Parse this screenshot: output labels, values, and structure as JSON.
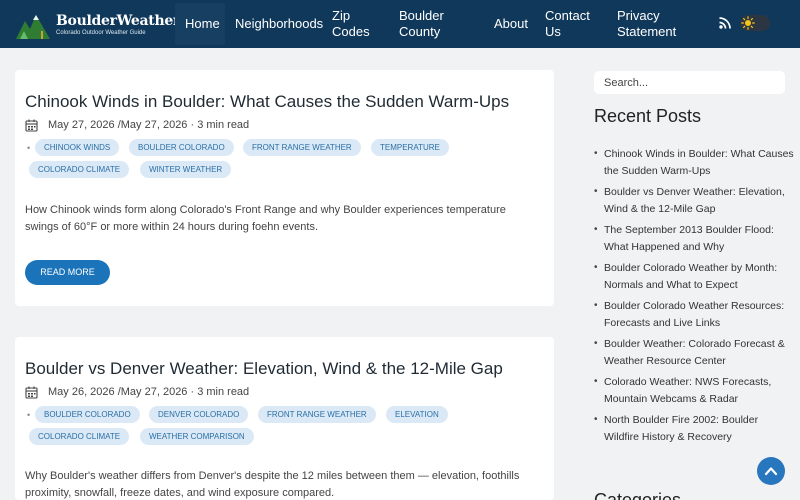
{
  "header": {
    "logo_title": "BoulderWeather.com",
    "logo_subtitle": "Colorado Outdoor Weather Guide",
    "nav": [
      {
        "label": "Home"
      },
      {
        "label": "Neighborhoods"
      },
      {
        "label": "Zip Codes"
      },
      {
        "label": "Boulder County"
      },
      {
        "label": "About"
      },
      {
        "label": "Contact Us"
      },
      {
        "label": "Privacy Statement"
      }
    ],
    "active_nav": "Home",
    "theme": "light"
  },
  "posts": [
    {
      "title": "Chinook Winds in Boulder: What Causes the Sudden Warm-Ups",
      "meta": "May 27, 2026 /May 27, 2026 · 3 min read",
      "tags": [
        "CHINOOK WINDS",
        "BOULDER COLORADO",
        "FRONT RANGE WEATHER",
        "TEMPERATURE",
        "COLORADO CLIMATE",
        "WINTER WEATHER"
      ],
      "excerpt": "How Chinook winds form along Colorado's Front Range and why Boulder experiences temperature swings of 60°F or more within 24 hours during foehn events.",
      "read_more": "READ MORE"
    },
    {
      "title": "Boulder vs Denver Weather: Elevation, Wind & the 12-Mile Gap",
      "meta": "May 26, 2026 /May 27, 2026 · 3 min read",
      "tags": [
        "BOULDER COLORADO",
        "DENVER COLORADO",
        "FRONT RANGE WEATHER",
        "ELEVATION",
        "COLORADO CLIMATE",
        "WEATHER COMPARISON"
      ],
      "excerpt": "Why Boulder's weather differs from Denver's despite the 12 miles between them — elevation, foothills proximity, snowfall, freeze dates, and wind exposure compared."
    }
  ],
  "sidebar": {
    "search_placeholder": "Search...",
    "recent_title": "Recent Posts",
    "recent_posts": [
      "Chinook Winds in Boulder: What Causes the Sudden Warm-Ups",
      "Boulder vs Denver Weather: Elevation, Wind & the 12-Mile Gap",
      "The September 2013 Boulder Flood: What Happened and Why",
      "Boulder Colorado Weather by Month: Normals and What to Expect",
      "Boulder Colorado Weather Resources: Forecasts and Live Links",
      "Boulder Weather: Colorado Forecast & Weather Resource Center",
      "Colorado Weather: NWS Forecasts, Mountain Webcams & Radar",
      "North Boulder Fire 2002: Boulder Wildfire History & Recovery"
    ],
    "categories_title": "Categories"
  },
  "colors": {
    "header_bg": "#10385a",
    "accent": "#1b73b9",
    "tag_bg": "#dbe9f6",
    "tag_text": "#2a6fa6"
  },
  "icons": [
    "logo-mountains-icon",
    "rss-icon",
    "sun-icon",
    "calendar-icon",
    "chevron-up-icon"
  ]
}
